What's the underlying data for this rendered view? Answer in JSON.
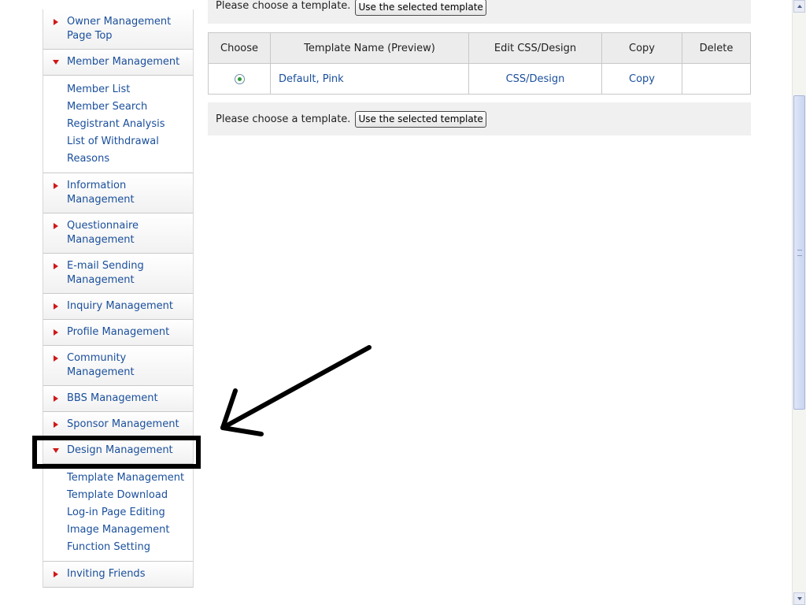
{
  "sidebar": {
    "groups": [
      {
        "label": "Owner Management Page Top",
        "expanded": false
      },
      {
        "label": "Member Management",
        "expanded": true,
        "items": [
          "Member List",
          "Member Search",
          "Registrant Analysis",
          "List of Withdrawal Reasons"
        ]
      },
      {
        "label": "Information Management",
        "expanded": false
      },
      {
        "label": "Questionnaire Management",
        "expanded": false
      },
      {
        "label": "E-mail Sending Management",
        "expanded": false
      },
      {
        "label": "Inquiry Management",
        "expanded": false
      },
      {
        "label": "Profile Management",
        "expanded": false
      },
      {
        "label": "Community Management",
        "expanded": false
      },
      {
        "label": "BBS Management",
        "expanded": false
      },
      {
        "label": "Sponsor Management",
        "expanded": false
      },
      {
        "label": "Design Management",
        "expanded": true,
        "items": [
          "Template Management",
          "Template Download",
          "Log-in Page Editing",
          "Image Management",
          "Function Setting"
        ]
      },
      {
        "label": "Inviting Friends",
        "expanded": false
      }
    ]
  },
  "main": {
    "choose_prompt": "Please choose a template.",
    "use_button_label": "Use the selected template",
    "table": {
      "headers": [
        "Choose",
        "Template Name (Preview)",
        "Edit CSS/Design",
        "Copy",
        "Delete"
      ],
      "rows": [
        {
          "selected": true,
          "name": "Default, Pink",
          "edit": "CSS/Design",
          "copy": "Copy",
          "delete": ""
        }
      ]
    }
  },
  "colors": {
    "link": "#1a4f9c",
    "nav_arrow": "#d01818",
    "highlight": "#000000"
  }
}
